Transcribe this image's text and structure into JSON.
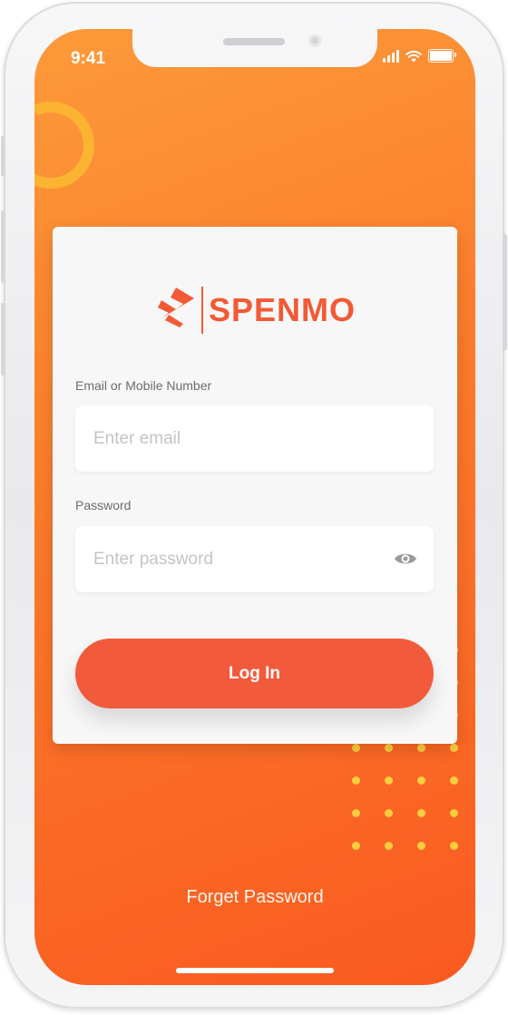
{
  "status_bar": {
    "time": "9:41"
  },
  "brand": {
    "name": "SPENMO",
    "color": "#f35a35"
  },
  "form": {
    "email_label": "Email or Mobile Number",
    "email_placeholder": "Enter email",
    "password_label": "Password",
    "password_placeholder": "Enter password",
    "password_toggle_icon": "eye-icon",
    "submit_label": "Log In"
  },
  "links": {
    "forgot_password": "Forget Password"
  },
  "colors": {
    "background_top": "#fd9a3a",
    "background_bottom": "#fa5a20",
    "button": "#f25a3c",
    "decoration": "#fbcd3f"
  }
}
